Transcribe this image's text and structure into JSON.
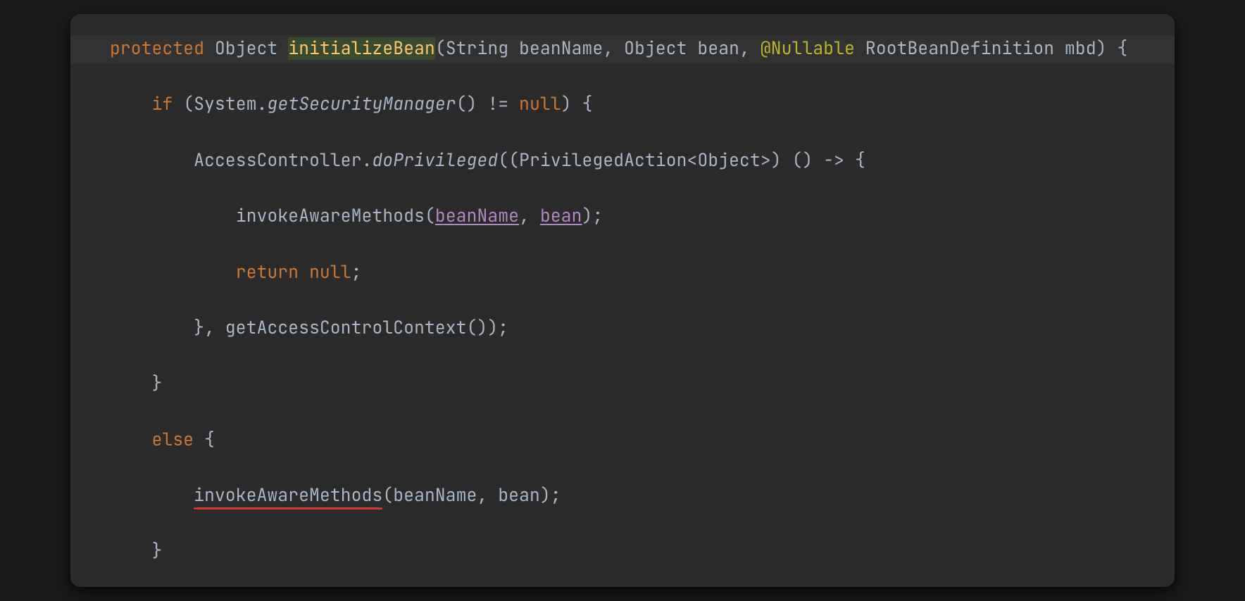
{
  "code": {
    "line1": {
      "kw_protected": "protected",
      "sp1": " ",
      "type_object": "Object",
      "sp2": " ",
      "decl_initialize": "initializeBean",
      "paren_open": "(",
      "type_string": "String",
      "sp3": " ",
      "p_beanName": "beanName",
      "comma1": ", ",
      "type_object2": "Object",
      "sp4": " ",
      "p_bean": "bean",
      "comma2": ", ",
      "ann_nullable": "@Nullable",
      "sp5": " ",
      "type_rbd": "RootBeanDefinition",
      "sp6": " ",
      "p_mbd": "mbd",
      "tail": ") {"
    },
    "line2": {
      "indent": "    ",
      "kw_if": "if",
      "sp": " (",
      "sys": "System",
      "dot": ".",
      "getSM": "getSecurityManager",
      "parens": "()",
      "neq": " != ",
      "null": "null",
      "tail": ") {"
    },
    "line3": {
      "indent": "        ",
      "ac": "AccessController",
      "dot": ".",
      "dp": "doPrivileged",
      "open": "((",
      "pa": "PrivilegedAction",
      "lt": "<",
      "obj": "Object",
      "gt": ">",
      "cast": ") () -> {"
    },
    "line4": {
      "indent": "            ",
      "call": "invokeAwareMethods",
      "open": "(",
      "arg1": "beanName",
      "comma": ", ",
      "arg2": "bean",
      "close": ");"
    },
    "line5": {
      "indent": "            ",
      "kw_return": "return",
      "sp": " ",
      "null": "null",
      "semi": ";"
    },
    "line6": {
      "indent": "        ",
      "close": "}, ",
      "call": "getAccessControlContext",
      "tail": "());"
    },
    "line7": {
      "indent": "    ",
      "brace": "}"
    },
    "line8": {
      "indent": "    ",
      "kw_else": "else",
      "brace": " {"
    },
    "line9": {
      "indent": "        ",
      "call": "invokeAwareMethods",
      "open": "(",
      "arg1": "beanName",
      "comma": ", ",
      "arg2": "bean",
      "close": ");"
    },
    "line10": {
      "indent": "    ",
      "brace": "}"
    }
  }
}
